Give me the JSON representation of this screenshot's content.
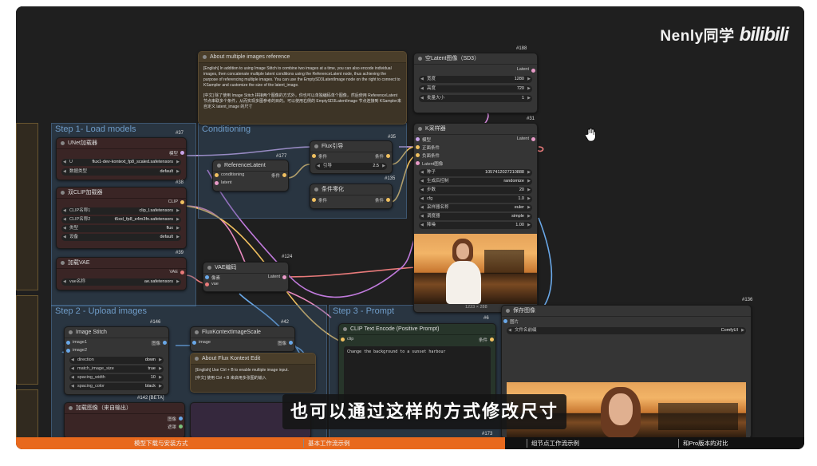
{
  "watermark": {
    "author": "Nenly同学",
    "site": "bilibili"
  },
  "subtitle": "也可以通过这样的方式修改尺寸",
  "chapters": [
    {
      "label": "模型下载与安装方式"
    },
    {
      "label": "基本工作流示例"
    },
    {
      "label": "组节点工作流示例"
    },
    {
      "label": "和Pro版本的对比"
    }
  ],
  "progress": 0.62,
  "colors": {
    "accent": "#e8691d",
    "group_blue": "#6f9cc8",
    "link_yellow": "#f0c060",
    "link_purple": "#c07adc",
    "link_pink": "#e87a7a",
    "link_blue": "#6aa8e8"
  },
  "groups": {
    "step1": "Step 1- Load models",
    "conditioning": "Conditioning",
    "step2": "Step 2 - Upload images",
    "step3": "Step 3 - Prompt"
  },
  "note_multi": {
    "title": "About multiple images reference",
    "en": "[English] In addition to using Image Stitch to combine two images at a time, you can also encode individual images, then concatenate multiple latent conditions using the ReferenceLatent node, thus achieving the purpose of referencing multiple images. You can use the EmptySD3LatentImage node on the right to connect to KSampler and customize the size of the latent_image.",
    "cn": "[中文] 除了使用 Image Stitch 拼接两个图像的方式外，你也可以单独编码单个图像，然后使用 ReferenceLatent 节点串联多个条件，从而实现多图参考的目的。可以使用右侧的 EmptySD3LatentImage 节点连接到 KSampler来自定义 latent_image 的尺寸"
  },
  "empty_latent": {
    "id": "#188",
    "title": "空Latent图像（SD3）",
    "out": "Latent",
    "widgets": [
      {
        "label": "宽度",
        "value": "1280"
      },
      {
        "label": "高度",
        "value": "720"
      },
      {
        "label": "批量大小",
        "value": "1"
      }
    ]
  },
  "ksampler": {
    "id": "#31",
    "title": "K采样器",
    "inputs": [
      "模型",
      "正面条件",
      "负面条件",
      "Latent图像"
    ],
    "out": "Latent",
    "widgets": [
      {
        "label": "种子",
        "value": "1057412027210888"
      },
      {
        "label": "生成后控制",
        "value": "randomize"
      },
      {
        "label": "步数",
        "value": "20"
      },
      {
        "label": "cfg",
        "value": "1.0"
      },
      {
        "label": "采样器名称",
        "value": "euler"
      },
      {
        "label": "调度器",
        "value": "simple"
      },
      {
        "label": "降噪",
        "value": "1.00"
      }
    ],
    "preview_caption": "1223 × 288"
  },
  "unet": {
    "id": "#37",
    "title": "UNet加载器",
    "out": "模型",
    "widgets": [
      {
        "label": "U",
        "value": "flux1-dev-kontext_fp8_scaled.safetensors"
      },
      {
        "label": "数据类型",
        "value": "default"
      }
    ]
  },
  "dualclip": {
    "id": "#38",
    "title": "双CLIP加载器",
    "out": "CLIP",
    "widgets": [
      {
        "label": "CLIP名称1",
        "value": "clip_l.safetensors"
      },
      {
        "label": "CLIP名称2",
        "value": "t5xxl_fp8_e4m3fn.safetensors"
      },
      {
        "label": "类型",
        "value": "flux"
      },
      {
        "label": "设备",
        "value": "default"
      }
    ]
  },
  "vae": {
    "id": "#39",
    "title": "加载VAE",
    "out": "VAE",
    "widgets": [
      {
        "label": "vae名称",
        "value": "ae.safetensors"
      }
    ]
  },
  "flux_guide": {
    "id": "#35",
    "title": "Flux引导",
    "in": "条件",
    "out": "条件",
    "widgets": [
      {
        "label": "引导",
        "value": "2.5"
      }
    ]
  },
  "ref_latent": {
    "id": "#177",
    "title": "ReferenceLatent",
    "ins": [
      "conditioning",
      "latent"
    ],
    "out": "条件"
  },
  "cond_zero": {
    "id": "#135",
    "title": "条件零化",
    "in": "条件",
    "out": "条件"
  },
  "vae_encode": {
    "id": "#124",
    "title": "VAE编码",
    "ins": [
      "像素",
      "vae"
    ],
    "out": "Latent"
  },
  "image_stitch": {
    "id": "#146",
    "title": "Image Stitch",
    "ins": [
      "image1",
      "image2"
    ],
    "out": "图像",
    "widgets": [
      {
        "label": "direction",
        "value": "down"
      },
      {
        "label": "match_image_size",
        "value": "true"
      },
      {
        "label": "spacing_width",
        "value": "10"
      },
      {
        "label": "spacing_color",
        "value": "black"
      }
    ]
  },
  "flux_scale": {
    "id": "#42",
    "title": "FluxKontextImageScale",
    "in": "image",
    "out": "图像"
  },
  "about_flux": {
    "title": "About Flux Kontext Edit",
    "en": "[English] Use Ctrl + B to enable multiple image input.",
    "cn": "[中文] 使用 Ctrl + B 来启用多张图的输入"
  },
  "load_image": {
    "id": "#142 [BETA]",
    "title": "加载图像（来自输出）",
    "outs": [
      "图像",
      "遮罩"
    ]
  },
  "clip_encode": {
    "id": "#6",
    "title": "CLIP Text Encode (Positive Prompt)",
    "in": "clip",
    "out": "条件",
    "prompt": "Change the background to a sunset harbour"
  },
  "save_image": {
    "id": "#136",
    "title": "保存图像",
    "in": "图片",
    "widget_label": "文件名前缀",
    "widget_value": "ComfyUI"
  },
  "other_ids": {
    "n173": "#173"
  }
}
